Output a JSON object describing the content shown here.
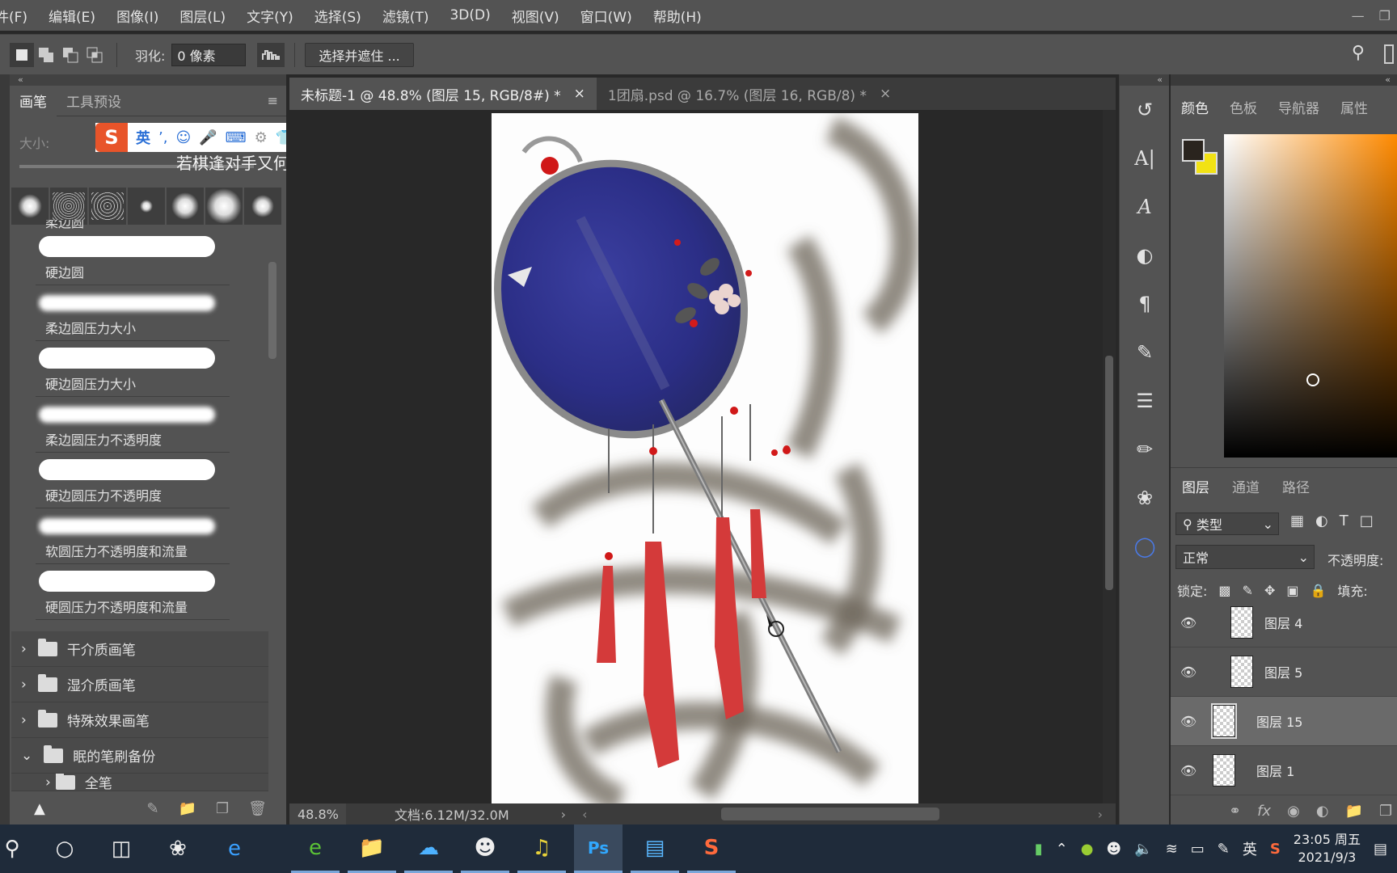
{
  "menu": [
    "件(F)",
    "编辑(E)",
    "图像(I)",
    "图层(L)",
    "文字(Y)",
    "选择(S)",
    "滤镜(T)",
    "3D(D)",
    "视图(V)",
    "窗口(W)",
    "帮助(H)"
  ],
  "options": {
    "feather_label": "羽化:",
    "feather_value": "0 像素",
    "select_mask_button": "选择并遮住 ..."
  },
  "brush_panel": {
    "tabs": [
      "画笔",
      "工具预设"
    ],
    "size_label": "大小:",
    "partial_label": "柔边圆",
    "brushes": [
      "硬边圆",
      "柔边圆压力大小",
      "硬边圆压力大小",
      "柔边圆压力不透明度",
      "硬边圆压力不透明度",
      "软圆压力不透明度和流量",
      "硬圆压力不透明度和流量"
    ],
    "folders": [
      "干介质画笔",
      "湿介质画笔",
      "特殊效果画笔",
      "眠的笔刷备份"
    ],
    "subfolder": "全笔"
  },
  "ime": {
    "logo": "S",
    "lang": "英"
  },
  "overlay_text": "若棋逢对手又何甘一败",
  "doc_tabs": [
    {
      "label": "未标题-1 @ 48.8% (图层 15, RGB/8#) *",
      "active": true
    },
    {
      "label": "1团扇.psd @ 16.7% (图层 16, RGB/8) *",
      "active": false
    }
  ],
  "status": {
    "zoom": "48.8%",
    "doc": "文档:6.12M/32.0M"
  },
  "color_panel": {
    "tabs": [
      "颜色",
      "色板",
      "导航器",
      "属性"
    ],
    "fg": "#2a241e",
    "bg": "#f2e214"
  },
  "layers_panel": {
    "tabs": [
      "图层",
      "通道",
      "路径"
    ],
    "filter": "类型",
    "blend_mode": "正常",
    "opacity_label": "不透明度:",
    "lock_label": "锁定:",
    "fill_label": "填充:",
    "layers": [
      {
        "name": "图层 4",
        "selected": false
      },
      {
        "name": "图层 5",
        "selected": false
      },
      {
        "name": "图层 15",
        "selected": true
      },
      {
        "name": "图层 1",
        "selected": false
      }
    ]
  },
  "taskbar": {
    "tray_lang": "英",
    "time": "23:05 周五",
    "date": "2021/9/3"
  }
}
